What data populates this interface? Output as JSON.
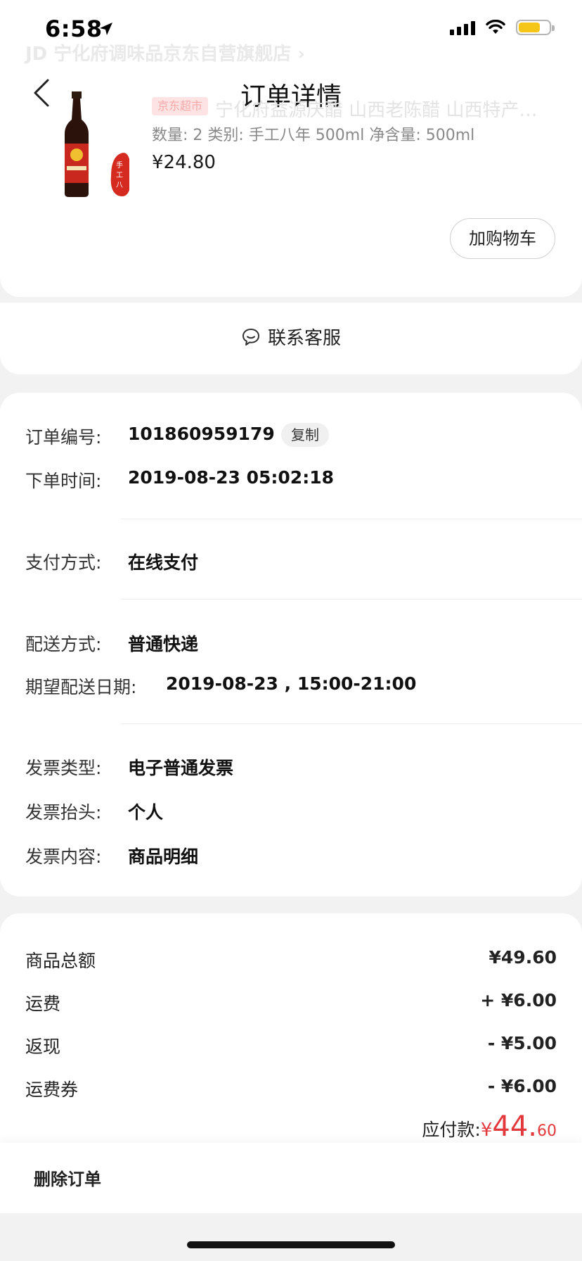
{
  "status_bar": {
    "time": "6:58"
  },
  "header": {
    "title": "订单详情",
    "shop_name": "JD 宁化府调味品京东自营旗舰店 ›"
  },
  "product": {
    "tag": "京东超市",
    "name": "宁化府益源庆醋 山西老陈醋 山西特产…",
    "spec": "数量: 2  类别: 手工八年  500ml  净含量: 500ml",
    "price": "¥24.80",
    "add_to_cart": "加购物车"
  },
  "service": {
    "label": "联系客服"
  },
  "order_info": {
    "order_no_label": "订单编号:",
    "order_no": "101860959179",
    "copy_label": "复制",
    "order_time_label": "下单时间:",
    "order_time": "2019-08-23 05:02:18",
    "payment_label": "支付方式:",
    "payment": "在线支付",
    "delivery_label": "配送方式:",
    "delivery": "普通快递",
    "expected_label": "期望配送日期:",
    "expected": "2019-08-23 , 15:00-21:00",
    "invoice_type_label": "发票类型:",
    "invoice_type": "电子普通发票",
    "invoice_title_label": "发票抬头:",
    "invoice_title": "个人",
    "invoice_content_label": "发票内容:",
    "invoice_content": "商品明细"
  },
  "price_info": {
    "rows": [
      {
        "label": "商品总额",
        "value": "¥49.60"
      },
      {
        "label": "运费",
        "value": "+ ¥6.00"
      },
      {
        "label": "返现",
        "value": "- ¥5.00"
      },
      {
        "label": "运费券",
        "value": "- ¥6.00"
      }
    ],
    "payable_label": "应付款:",
    "payable_symbol": "¥",
    "payable_int": "44.",
    "payable_dec": "60"
  },
  "footer": {
    "delete_label": "删除订单"
  },
  "colors": {
    "accent": "#e4393c",
    "battery": "#f5c518"
  }
}
